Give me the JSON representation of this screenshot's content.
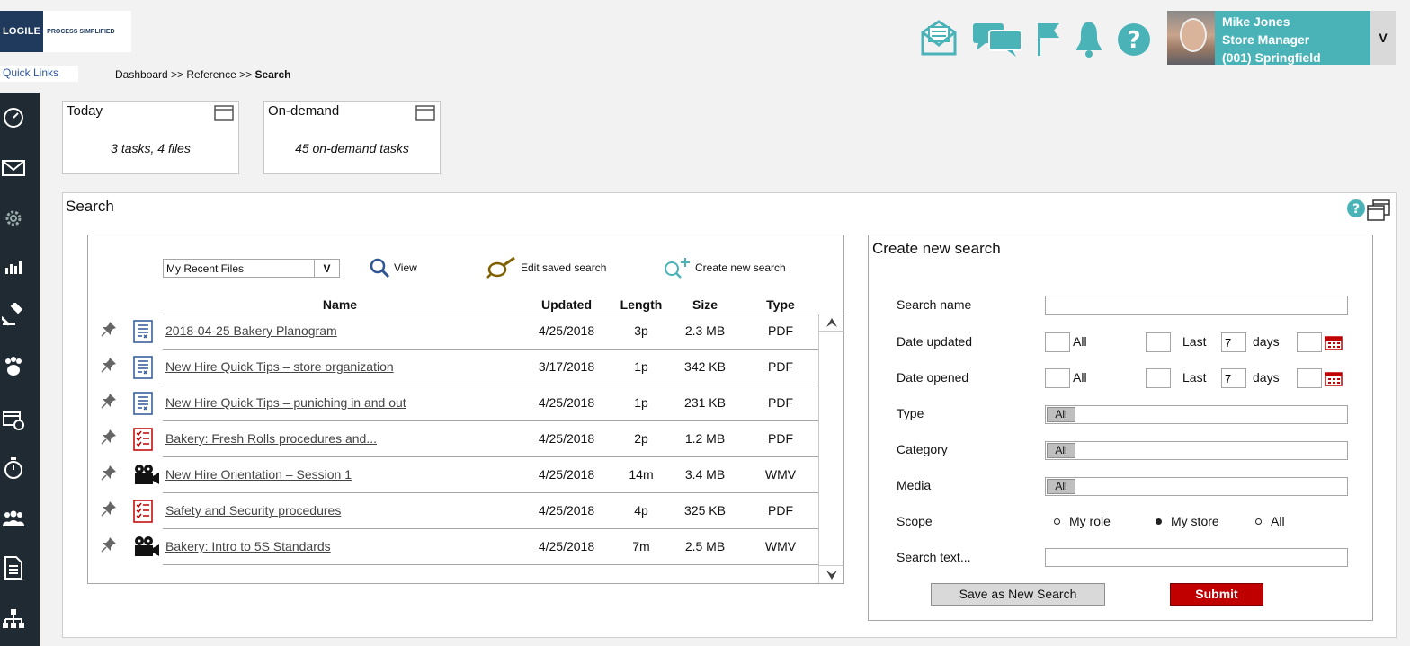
{
  "brand": {
    "logo_text": "LOGILE",
    "tagline": "PROCESS SIMPLIFIED"
  },
  "quick_links": "Quick Links",
  "breadcrumb": {
    "part1": "Dashboard >> Reference >> ",
    "current": "Search"
  },
  "top_icons": [
    "mail-icon",
    "chat-icon",
    "flag-icon",
    "bell-icon",
    "help-icon"
  ],
  "user": {
    "name": "Mike Jones",
    "role": "Store Manager",
    "store": "(001) Springfield",
    "menu_label": "V"
  },
  "sidebar_icons": [
    "dashboard-icon",
    "envelope-icon",
    "gear-icon",
    "chart-icon",
    "gavel-icon",
    "paw-icon",
    "calendar-clock-icon",
    "stopwatch-icon",
    "team-icon",
    "document-icon",
    "org-chart-icon"
  ],
  "cards": [
    {
      "title": "Today",
      "subtitle": "3 tasks, 4 files"
    },
    {
      "title": "On-demand",
      "subtitle": "45 on-demand tasks"
    }
  ],
  "search": {
    "title": "Search",
    "dropdown": {
      "value": "My Recent Files",
      "arrow": "V"
    },
    "tools": {
      "view": "View",
      "edit": "Edit saved search",
      "create": "Create new search"
    },
    "columns": [
      "Name",
      "Updated",
      "Length",
      "Size",
      "Type"
    ],
    "rows": [
      {
        "icon": "document-icon",
        "name": "2018-04-25 Bakery Planogram",
        "updated": "4/25/2018",
        "length": "3p",
        "size": "2.3 MB",
        "type": "PDF"
      },
      {
        "icon": "document-icon",
        "name": "New Hire Quick Tips – store organization",
        "updated": "3/17/2018",
        "length": "1p",
        "size": "342 KB",
        "type": "PDF"
      },
      {
        "icon": "document-icon",
        "name": "New Hire Quick Tips – puniching in and out",
        "updated": "4/25/2018",
        "length": "1p",
        "size": "231 KB",
        "type": "PDF"
      },
      {
        "icon": "checklist-icon",
        "name": "Bakery: Fresh Rolls procedures and...",
        "updated": "4/25/2018",
        "length": "2p",
        "size": "1.2 MB",
        "type": "PDF"
      },
      {
        "icon": "video-camera-icon",
        "name": "New Hire Orientation – Session 1",
        "updated": "4/25/2018",
        "length": "14m",
        "size": "3.4 MB",
        "type": "WMV"
      },
      {
        "icon": "checklist-icon",
        "name": "Safety and Security procedures",
        "updated": "4/25/2018",
        "length": "4p",
        "size": "325 KB",
        "type": "PDF"
      },
      {
        "icon": "video-camera-icon",
        "name": "Bakery: Intro to 5S Standards",
        "updated": "4/25/2018",
        "length": "7m",
        "size": "2.5 MB",
        "type": "WMV"
      }
    ]
  },
  "create": {
    "title": "Create new search",
    "labels": {
      "search_name": "Search name",
      "date_updated": "Date updated",
      "date_opened": "Date opened",
      "type": "Type",
      "category": "Category",
      "media": "Media",
      "scope": "Scope",
      "search_text": "Search text..."
    },
    "date_words": {
      "all": "All",
      "last": "Last",
      "days": "days"
    },
    "date_updated_days": "7",
    "date_opened_days": "7",
    "type_value": "All",
    "category_value": "All",
    "media_value": "All",
    "scope_options": [
      {
        "label": "My role",
        "selected": false
      },
      {
        "label": "My store",
        "selected": true
      },
      {
        "label": "All",
        "selected": false
      }
    ],
    "buttons": {
      "save": "Save as New Search",
      "submit": "Submit"
    }
  },
  "colors": {
    "teal": "#4ab3b8",
    "sidebar": "#1f2a33",
    "submit": "#c00000"
  }
}
